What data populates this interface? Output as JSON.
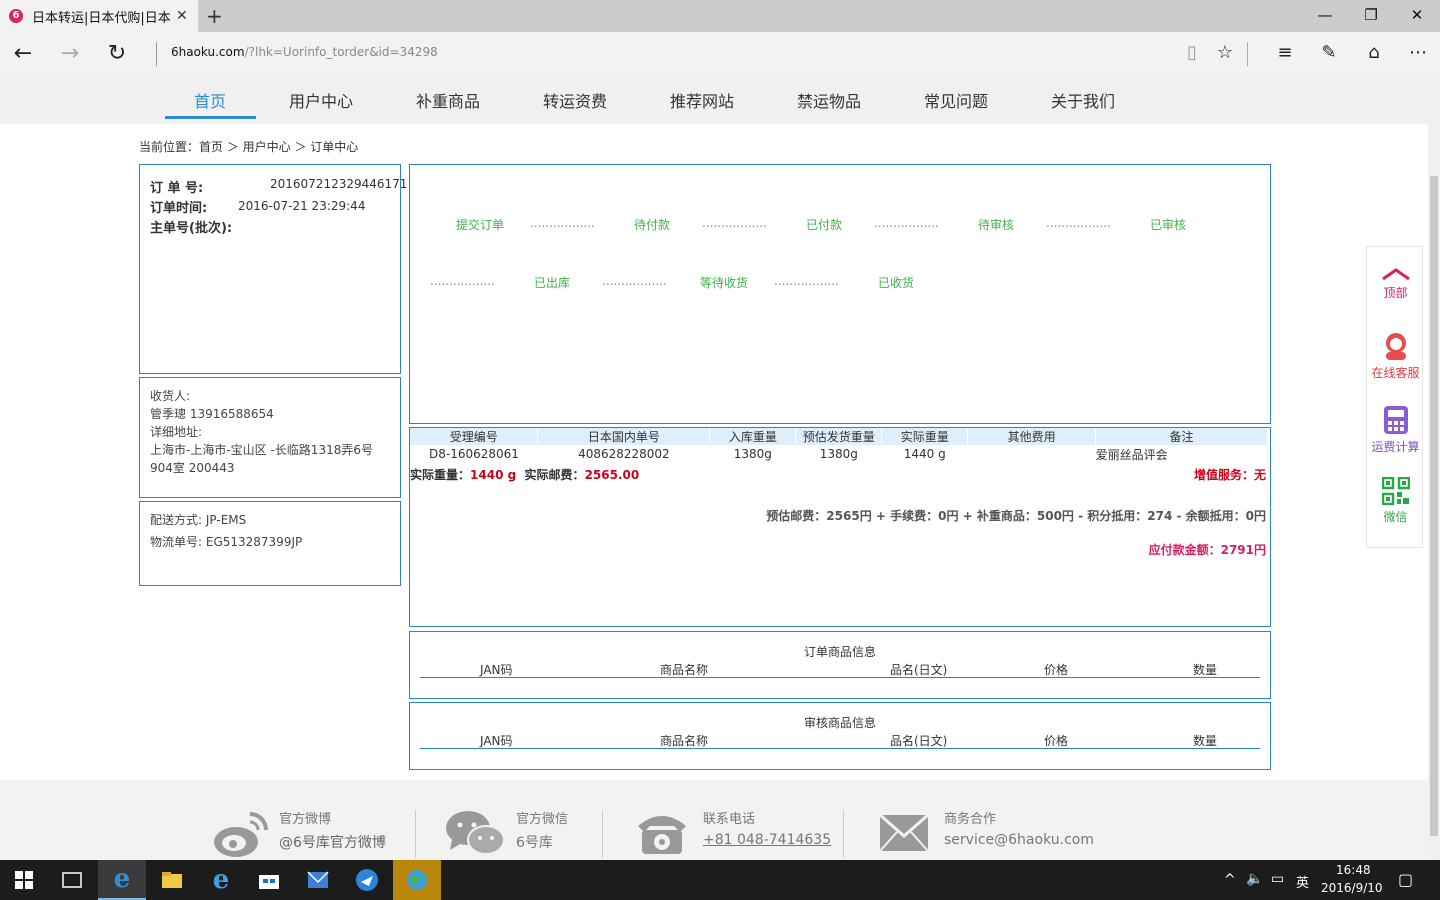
{
  "browser": {
    "tab_title": "日本转运|日本代购|日本",
    "tab_favicon": "6",
    "url_host": "6haoku.com",
    "url_path": "/?lhk=Uorinfo_torder&id=34298"
  },
  "menu": {
    "items": [
      "首页",
      "用户中心",
      "补重商品",
      "转运资费",
      "推荐网站",
      "禁运物品",
      "常见问题",
      "关于我们"
    ],
    "active_index": 0
  },
  "breadcrumb": "当前位置：首页 ＞ 用户中心 ＞ 订单中心",
  "order": {
    "number_label": "订 单 号:",
    "number": "201607212329446171",
    "time_label": "订单时间:",
    "time": "2016-07-21 23:29:44",
    "master_label": "主单号(批次):"
  },
  "receiver": {
    "label": "收货人:",
    "name_phone": "管季璁 13916588654",
    "address_label": "详细地址:",
    "address_line1": "上海市-上海市-宝山区 -长临路1318弄6号",
    "address_line2": "904室 200443"
  },
  "shipping": {
    "method": "配送方式: JP-EMS",
    "tracking": "物流单号: EG513287399JP"
  },
  "progress": {
    "row1": [
      "提交订单",
      "待付款",
      "已付款",
      "待审核",
      "已审核"
    ],
    "row2": [
      "已出库",
      "等待收货",
      "已收货"
    ],
    "dots": "................."
  },
  "items_table": {
    "headers": [
      "受理编号",
      "日本国内单号",
      "入库重量",
      "预估发货重量",
      "实际重量",
      "其他费用",
      "备注"
    ],
    "row": [
      "D8-160628061",
      "408628228002",
      "1380g",
      "1380g",
      "1440 g",
      "",
      "爱丽丝品评会"
    ]
  },
  "summary": {
    "actual_weight_label": "实际重量：",
    "actual_weight": "1440 g",
    "actual_postage_label": "实际邮费：",
    "actual_postage": "2565.00",
    "value_added": "增值服务：无",
    "fee_breakdown": "预估邮费：2565円 + 手续费：0円 + 补重商品：500円 - 积分抵用：274 - 余额抵用：0円",
    "amount_due": "应付款金额：2791円"
  },
  "order_goods": {
    "title": "订单商品信息",
    "columns": [
      "JAN码",
      "商品名称",
      "品名(日文)",
      "价格",
      "数量"
    ]
  },
  "review_goods": {
    "title": "审核商品信息",
    "columns": [
      "JAN码",
      "商品名称",
      "品名(日文)",
      "价格",
      "数量"
    ]
  },
  "side_panel": {
    "top": "顶部",
    "service": "在线客服",
    "calc": "运费计算",
    "wechat": "微信"
  },
  "footer": {
    "weibo_label": "官方微博",
    "weibo_val": "@6号库官方微博",
    "wechat_label": "官方微信",
    "wechat_val": "6号库",
    "phone_label": "联系电话",
    "phone_val": "+81 048-7414635",
    "biz_label": "商务合作",
    "biz_val": "service@6haoku.com"
  },
  "taskbar": {
    "time": "16:48",
    "date": "2016/9/10",
    "ime": "英"
  },
  "colors": {
    "accent": "#2a8dd4",
    "border": "#2a86c2",
    "step_green": "#3cb34a",
    "red": "#d0021b",
    "pink": "#d81e5b"
  }
}
